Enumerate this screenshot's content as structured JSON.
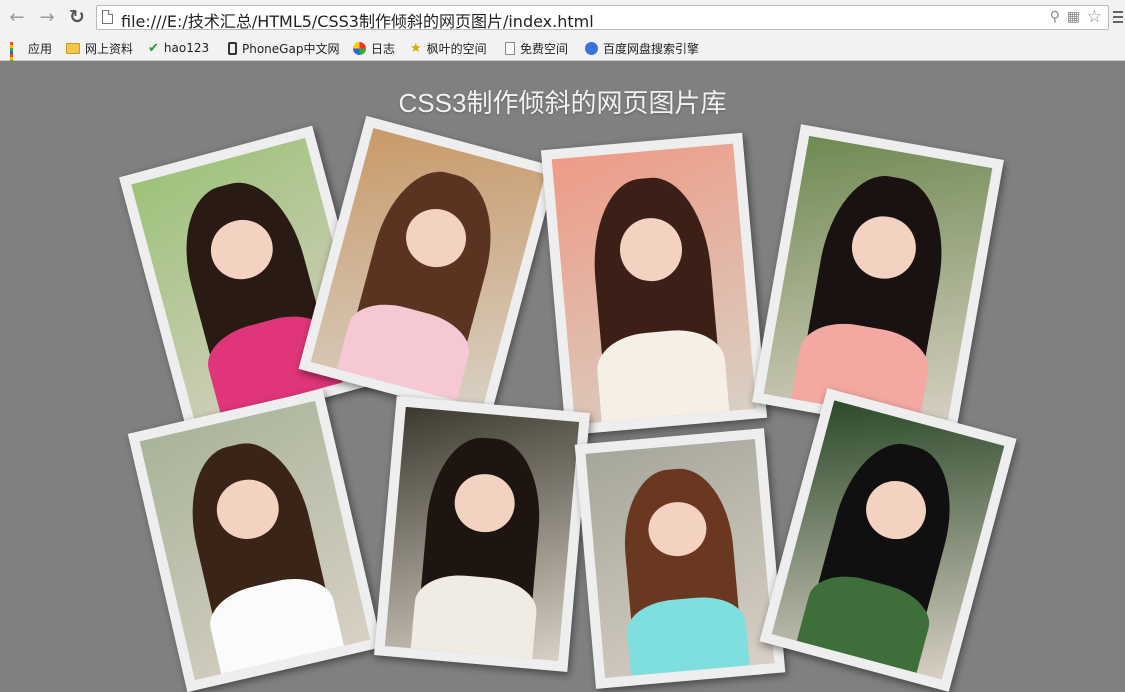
{
  "browser": {
    "url": "file:///E:/技术汇总/HTML5/CSS3制作倾斜的网页图片/index.html",
    "bookmarks": [
      {
        "label": "应用",
        "icon": "apps-icon"
      },
      {
        "label": "网上资料",
        "icon": "folder-icon"
      },
      {
        "label": "hao123",
        "icon": "hao123-icon"
      },
      {
        "label": "PhoneGap中文网",
        "icon": "phone-icon"
      },
      {
        "label": "日志",
        "icon": "colorful-circle-icon"
      },
      {
        "label": "枫叶的空间",
        "icon": "star-icon"
      },
      {
        "label": "免费空间",
        "icon": "document-icon"
      },
      {
        "label": "百度网盘搜索引擎",
        "icon": "baidu-icon"
      }
    ]
  },
  "page": {
    "title": "CSS3制作倾斜的网页图片库"
  },
  "photos": [
    {
      "name": "photo-1",
      "rotation_deg": -15,
      "bg": "#9dc27a",
      "hair": "#2a1a14",
      "outfit": "#e0357a"
    },
    {
      "name": "photo-2",
      "rotation_deg": 15,
      "bg": "#c99a6a",
      "hair": "#5a3420",
      "outfit": "#f5c8d4"
    },
    {
      "name": "photo-3",
      "rotation_deg": -5,
      "bg": "#ee9b86",
      "hair": "#3c2018",
      "outfit": "#f6efe6"
    },
    {
      "name": "photo-4",
      "rotation_deg": 10,
      "bg": "#6e8a52",
      "hair": "#1a1210",
      "outfit": "#f4a8a2"
    },
    {
      "name": "photo-5",
      "rotation_deg": -13,
      "bg": "#a8b49a",
      "hair": "#3a2418",
      "outfit": "#fbfbfb"
    },
    {
      "name": "photo-6",
      "rotation_deg": 5,
      "bg": "#3c3a30",
      "hair": "#1e1410",
      "outfit": "#f0ece4"
    },
    {
      "name": "photo-7",
      "rotation_deg": -5,
      "bg": "#a6a69a",
      "hair": "#6a3820",
      "outfit": "#7fdede"
    },
    {
      "name": "photo-8",
      "rotation_deg": 15,
      "bg": "#2c4a2a",
      "hair": "#101010",
      "outfit": "#3e6e3a"
    }
  ]
}
